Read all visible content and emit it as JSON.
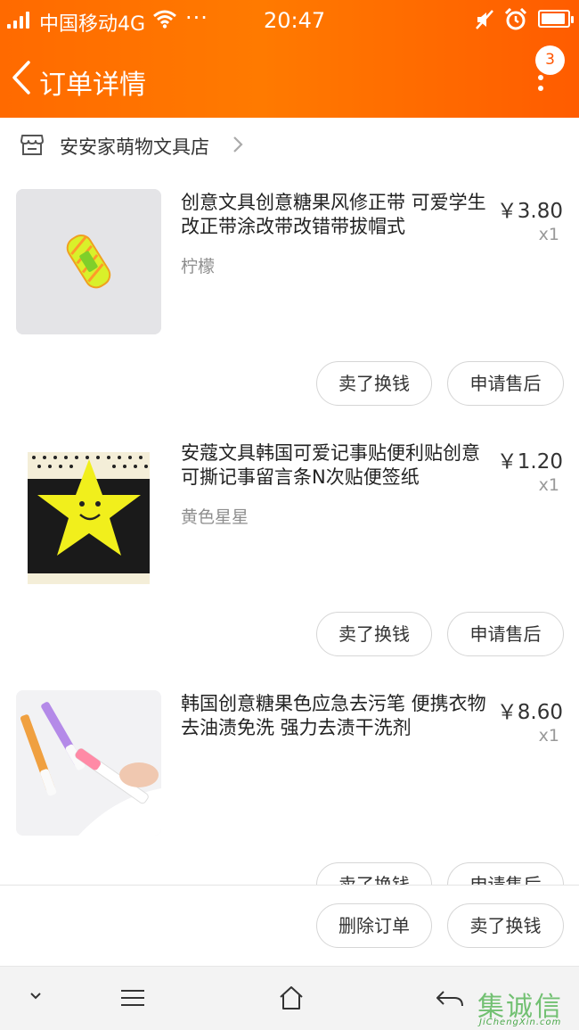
{
  "status_bar": {
    "carrier": "中国移动4G",
    "dots": "···",
    "time": "20:47"
  },
  "nav": {
    "title": "订单详情",
    "badge_count": "3"
  },
  "shop": {
    "name": "安安家萌物文具店"
  },
  "items": [
    {
      "title": "创意文具创意糖果风修正带 可爱学生改正带涂改带改错带拔帽式",
      "spec": "柠檬",
      "price": "￥3.80",
      "qty": "x1",
      "sell_label": "卖了换钱",
      "aftersale_label": "申请售后"
    },
    {
      "title": "安蔻文具韩国可爱记事贴便利贴创意可撕记事留言条N次贴便签纸",
      "spec": "黄色星星",
      "price": "￥1.20",
      "qty": "x1",
      "sell_label": "卖了换钱",
      "aftersale_label": "申请售后"
    },
    {
      "title": "韩国创意糖果色应急去污笔 便携衣物去油渍免洗 强力去渍干洗剂",
      "spec": "",
      "price": "￥8.60",
      "qty": "x1",
      "sell_label": "卖了换钱",
      "aftersale_label": "申请售后"
    }
  ],
  "bottom_bar": {
    "delete_label": "删除订单",
    "sell_label": "卖了换钱"
  },
  "watermark": {
    "text": "集诚信",
    "sub": "JiChengXin.com"
  },
  "colors": {
    "header_orange": "#ff6a00",
    "badge_text": "#ff5500",
    "watermark_green": "#5cb85c"
  }
}
